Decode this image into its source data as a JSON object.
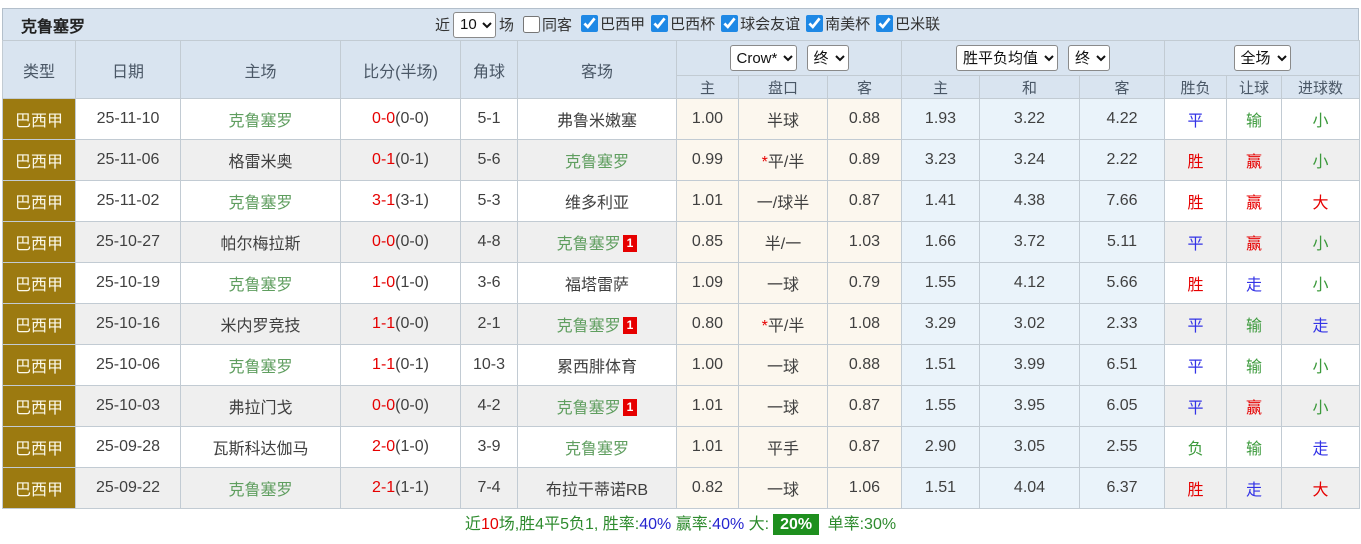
{
  "team": "克鲁塞罗",
  "colors": {
    "header_bg": "#d9e4f0",
    "league_column_bg": "#9c7a10",
    "stripe_bg": "#efefef",
    "handicap_tint_bg": "#fcf7ee",
    "avg_tint_bg": "#eaf3fa",
    "self_team_green": "#5f9e5f",
    "win_red": "#e60000",
    "draw_blue": "#3333e6",
    "lose_green": "#3c9a3c",
    "checkbox_blue": "#1e88e5",
    "footer_badge_green": "#1e8f1e"
  },
  "toolbar": {
    "title": "克鲁塞罗",
    "recent_label": "近",
    "recent_value": "10",
    "games_label": "场",
    "same_opponent": {
      "label": "同客",
      "checked": false
    },
    "competitions": [
      {
        "label": "巴西甲",
        "checked": true
      },
      {
        "label": "巴西杯",
        "checked": true
      },
      {
        "label": "球会友谊",
        "checked": true
      },
      {
        "label": "南美杯",
        "checked": true
      },
      {
        "label": "巴米联",
        "checked": true
      }
    ]
  },
  "table": {
    "columns": [
      "类型",
      "日期",
      "主场",
      "比分(半场)",
      "角球",
      "客场"
    ],
    "odds_groups": {
      "crow": {
        "company_select": "Crow*",
        "time_select": "终"
      },
      "avg": {
        "company_select": "胜平负均值",
        "time_select": "终"
      },
      "result": {
        "scope_select": "全场"
      }
    },
    "sub": [
      "主",
      "盘口",
      "客",
      "主",
      "和",
      "客",
      "胜负",
      "让球",
      "进球数"
    ],
    "rows": [
      {
        "league": "巴西甲",
        "date": "25-11-10",
        "home": "克鲁塞罗",
        "home_badge": "",
        "score_ft": "0-0",
        "score_ht": "(0-0)",
        "corners": "5-1",
        "away": "弗鲁米嫩塞",
        "away_badge": "",
        "crow_home": "1.00",
        "crow_line": "半球",
        "crow_away": "0.88",
        "avg_home": "1.93",
        "avg_draw": "3.22",
        "avg_away": "4.22",
        "result": "平",
        "handicap": "输",
        "goals": "小"
      },
      {
        "league": "巴西甲",
        "date": "25-11-06",
        "home": "格雷米奥",
        "home_badge": "",
        "score_ft": "0-1",
        "score_ht": "(0-1)",
        "corners": "5-6",
        "away": "克鲁塞罗",
        "away_badge": "",
        "crow_home": "0.99",
        "crow_line": "*平/半",
        "crow_away": "0.89",
        "avg_home": "3.23",
        "avg_draw": "3.24",
        "avg_away": "2.22",
        "result": "胜",
        "handicap": "赢",
        "goals": "小"
      },
      {
        "league": "巴西甲",
        "date": "25-11-02",
        "home": "克鲁塞罗",
        "home_badge": "",
        "score_ft": "3-1",
        "score_ht": "(3-1)",
        "corners": "5-3",
        "away": "维多利亚",
        "away_badge": "",
        "crow_home": "1.01",
        "crow_line": "一/球半",
        "crow_away": "0.87",
        "avg_home": "1.41",
        "avg_draw": "4.38",
        "avg_away": "7.66",
        "result": "胜",
        "handicap": "赢",
        "goals": "大"
      },
      {
        "league": "巴西甲",
        "date": "25-10-27",
        "home": "帕尔梅拉斯",
        "home_badge": "",
        "score_ft": "0-0",
        "score_ht": "(0-0)",
        "corners": "4-8",
        "away": "克鲁塞罗",
        "away_badge": "1",
        "crow_home": "0.85",
        "crow_line": "半/一",
        "crow_away": "1.03",
        "avg_home": "1.66",
        "avg_draw": "3.72",
        "avg_away": "5.11",
        "result": "平",
        "handicap": "赢",
        "goals": "小"
      },
      {
        "league": "巴西甲",
        "date": "25-10-19",
        "home": "克鲁塞罗",
        "home_badge": "",
        "score_ft": "1-0",
        "score_ht": "(1-0)",
        "corners": "3-6",
        "away": "福塔雷萨",
        "away_badge": "",
        "crow_home": "1.09",
        "crow_line": "一球",
        "crow_away": "0.79",
        "avg_home": "1.55",
        "avg_draw": "4.12",
        "avg_away": "5.66",
        "result": "胜",
        "handicap": "走",
        "goals": "小"
      },
      {
        "league": "巴西甲",
        "date": "25-10-16",
        "home": "米内罗竞技",
        "home_badge": "",
        "score_ft": "1-1",
        "score_ht": "(0-0)",
        "corners": "2-1",
        "away": "克鲁塞罗",
        "away_badge": "1",
        "crow_home": "0.80",
        "crow_line": "*平/半",
        "crow_away": "1.08",
        "avg_home": "3.29",
        "avg_draw": "3.02",
        "avg_away": "2.33",
        "result": "平",
        "handicap": "输",
        "goals": "走"
      },
      {
        "league": "巴西甲",
        "date": "25-10-06",
        "home": "克鲁塞罗",
        "home_badge": "",
        "score_ft": "1-1",
        "score_ht": "(0-1)",
        "corners": "10-3",
        "away": "累西腓体育",
        "away_badge": "",
        "crow_home": "1.00",
        "crow_line": "一球",
        "crow_away": "0.88",
        "avg_home": "1.51",
        "avg_draw": "3.99",
        "avg_away": "6.51",
        "result": "平",
        "handicap": "输",
        "goals": "小"
      },
      {
        "league": "巴西甲",
        "date": "25-10-03",
        "home": "弗拉门戈",
        "home_badge": "",
        "score_ft": "0-0",
        "score_ht": "(0-0)",
        "corners": "4-2",
        "away": "克鲁塞罗",
        "away_badge": "1",
        "crow_home": "1.01",
        "crow_line": "一球",
        "crow_away": "0.87",
        "avg_home": "1.55",
        "avg_draw": "3.95",
        "avg_away": "6.05",
        "result": "平",
        "handicap": "赢",
        "goals": "小"
      },
      {
        "league": "巴西甲",
        "date": "25-09-28",
        "home": "瓦斯科达伽马",
        "home_badge": "",
        "score_ft": "2-0",
        "score_ht": "(1-0)",
        "corners": "3-9",
        "away": "克鲁塞罗",
        "away_badge": "",
        "crow_home": "1.01",
        "crow_line": "平手",
        "crow_away": "0.87",
        "avg_home": "2.90",
        "avg_draw": "3.05",
        "avg_away": "2.55",
        "result": "负",
        "handicap": "输",
        "goals": "走"
      },
      {
        "league": "巴西甲",
        "date": "25-09-22",
        "home": "克鲁塞罗",
        "home_badge": "",
        "score_ft": "2-1",
        "score_ht": "(1-1)",
        "corners": "7-4",
        "away": "布拉干蒂诺RB",
        "away_badge": "",
        "crow_home": "0.82",
        "crow_line": "一球",
        "crow_away": "1.06",
        "avg_home": "1.51",
        "avg_draw": "4.04",
        "avg_away": "6.37",
        "result": "胜",
        "handicap": "走",
        "goals": "大"
      }
    ]
  },
  "footer": {
    "segments": [
      {
        "text": "近",
        "style": "green"
      },
      {
        "text": "10",
        "style": "red"
      },
      {
        "text": "场,胜4平5负1, ",
        "style": "green"
      },
      {
        "text": "胜率:",
        "style": "green"
      },
      {
        "text": "40%",
        "style": "blue"
      },
      {
        "text": " 赢率:",
        "style": "green"
      },
      {
        "text": "40%",
        "style": "blue"
      },
      {
        "text": " 大:",
        "style": "green"
      },
      {
        "text": "20%",
        "style": "badge"
      },
      {
        "text": " 单率:",
        "style": "green"
      },
      {
        "text": "30%",
        "style": "green"
      }
    ]
  }
}
